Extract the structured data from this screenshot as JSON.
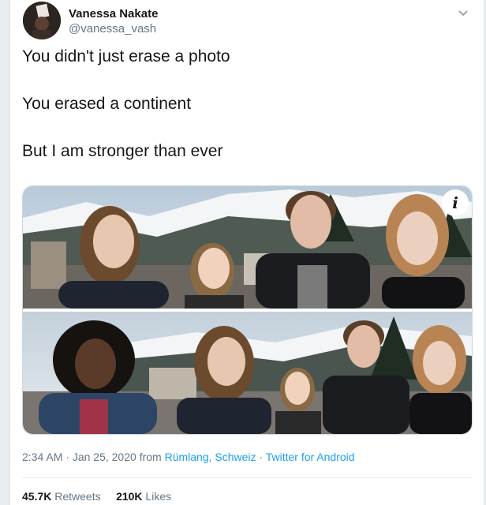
{
  "user": {
    "name": "Vanessa Nakate",
    "handle": "@vanessa_vash"
  },
  "tweet": {
    "lines": [
      "You didn't just erase a photo",
      "You erased a continent",
      "But I am stronger than ever"
    ]
  },
  "media": {
    "info_glyph": "i"
  },
  "meta": {
    "time": "2:34 AM",
    "date": "Jan 25, 2020",
    "from_word": "from",
    "location": "Rümlang, Schweiz",
    "client": "Twitter for Android",
    "sep": "·"
  },
  "stats": {
    "retweets_count": "45.7K",
    "retweets_label": "Retweets",
    "likes_count": "210K",
    "likes_label": "Likes"
  },
  "colors": {
    "link": "#1da1f2",
    "secondary": "#657786",
    "text": "#14171a"
  }
}
